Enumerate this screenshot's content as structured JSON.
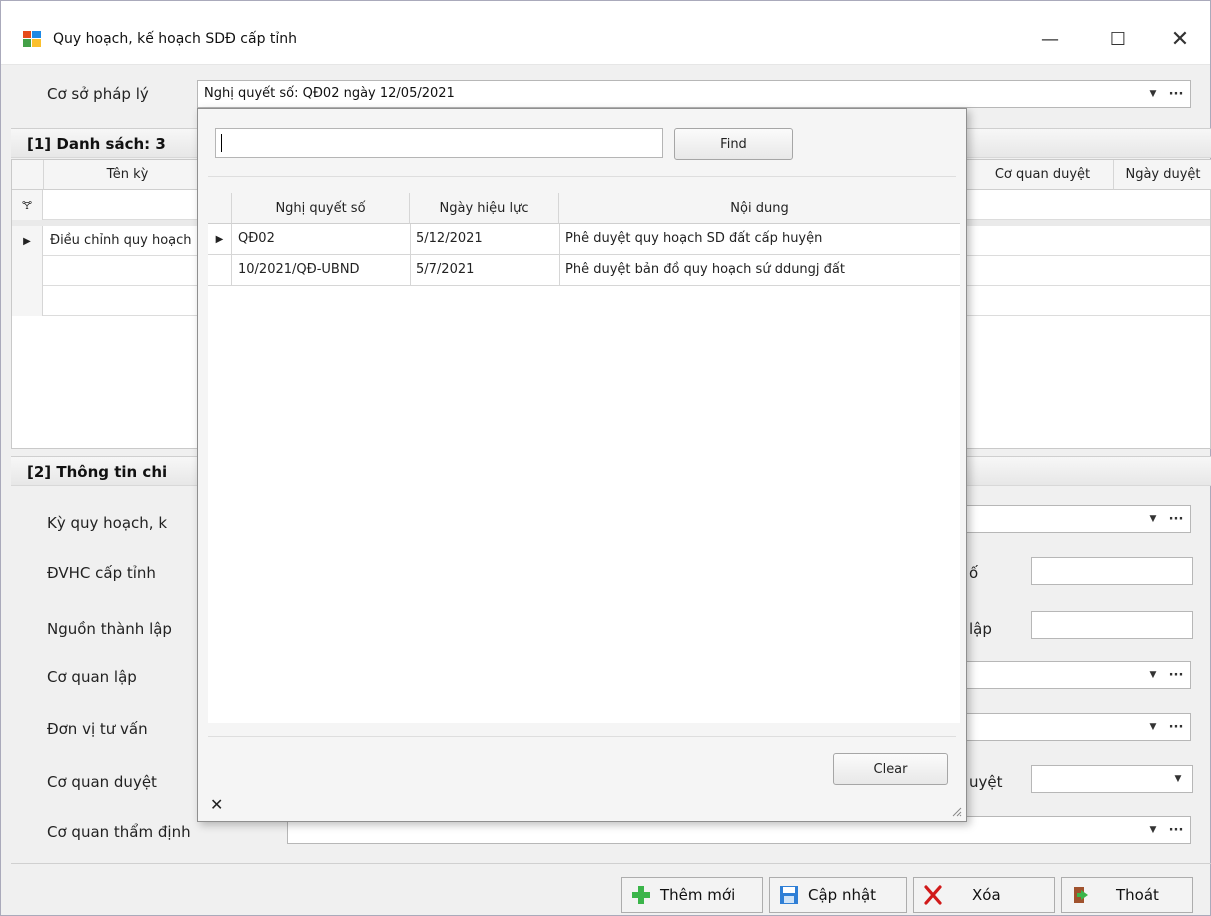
{
  "window": {
    "title": "Quy hoạch, kế hoạch SDĐ cấp tỉnh",
    "minimize": "—",
    "maximize": "☐",
    "close": "✕"
  },
  "legal_basis": {
    "label": "Cơ sở pháp lý",
    "value": "Nghị quyết số: QĐ02 ngày 12/05/2021"
  },
  "list_section": {
    "title": "[1] Danh sách: 3",
    "columns": [
      "Tên kỳ",
      "Cơ quan duyệt",
      "Ngày duyệt"
    ],
    "filter_icon": "🝖",
    "rows": [
      {
        "name": "Điều chỉnh quy hoạch"
      }
    ]
  },
  "detail_section": {
    "title": "[2] Thông tin chi",
    "fields": {
      "ky_quy_hoach": "Kỳ quy hoạch, k",
      "dvhc": "ĐVHC cấp tỉnh",
      "nguon": "Nguồn thành lập",
      "co_quan_lap": "Cơ quan lập",
      "don_vi_tu_van": "Đơn vị tư vấn",
      "co_quan_duyet": "Cơ quan duyệt",
      "co_quan_tham_dinh": "Cơ quan thẩm định",
      "right_label_1": "ố",
      "right_label_2": "lập",
      "right_label_3": "uyệt"
    }
  },
  "popup": {
    "find_label": "Find",
    "clear_label": "Clear",
    "close_glyph": "✕",
    "columns": [
      "Nghị quyết số",
      "Ngày hiệu lực",
      "Nội dung"
    ],
    "rows": [
      {
        "so": "QĐ02",
        "ngay": "5/12/2021",
        "noi_dung": "Phê duyệt quy hoạch SD đất cấp huyện"
      },
      {
        "so": "10/2021/QĐ-UBND",
        "ngay": "5/7/2021",
        "noi_dung": "Phê duyệt bản đồ quy hoạch sứ ddungj đất"
      }
    ]
  },
  "buttons": {
    "add": "Thêm mới",
    "update": "Cập nhật",
    "delete": "Xóa",
    "exit": "Thoát"
  },
  "colors": {
    "accent": "#2f7fd6",
    "add_icon": "#3bb54a",
    "delete_icon": "#d11a1a"
  }
}
